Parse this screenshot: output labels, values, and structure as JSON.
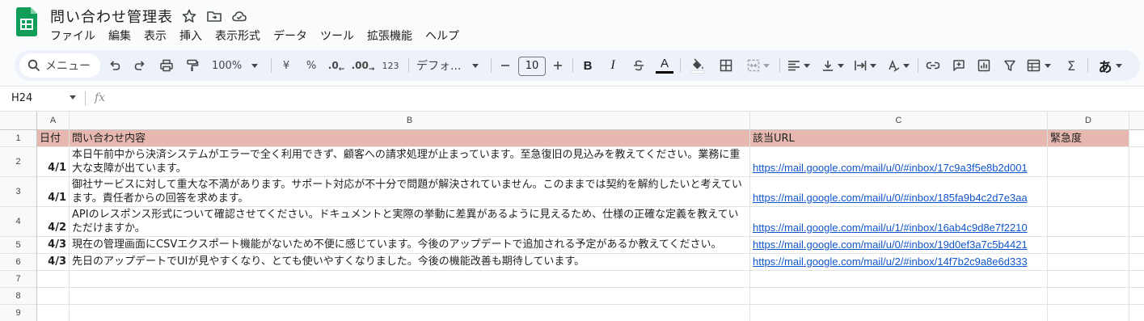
{
  "doc": {
    "title": "問い合わせ管理表"
  },
  "menu": [
    "ファイル",
    "編集",
    "表示",
    "挿入",
    "表示形式",
    "データ",
    "ツール",
    "拡張機能",
    "ヘルプ"
  ],
  "toolbar": {
    "search_label": "メニュー",
    "zoom": "100%",
    "currency": "¥",
    "percent": "%",
    "dec_decrease": ".0",
    "dec_increase": ".00",
    "number_format": "123",
    "font": "デフォ...",
    "font_size": "10",
    "bold": "B",
    "italic": "I",
    "text_color_letter": "A",
    "ime": "あ"
  },
  "formula_bar": {
    "name_box": "H24",
    "fx": "fx"
  },
  "columns": [
    "A",
    "B",
    "C",
    "D"
  ],
  "rows": [
    "1",
    "2",
    "3",
    "4",
    "5",
    "6",
    "7",
    "8",
    "9"
  ],
  "header_row": {
    "a": "日付",
    "b": "問い合わせ内容",
    "c": "該当URL",
    "d": "緊急度"
  },
  "data_rows": [
    {
      "date": "4/1",
      "content": "本日午前中から決済システムがエラーで全く利用できず、顧客への請求処理が止まっています。至急復旧の見込みを教えてください。業務に重大な支障が出ています。",
      "url": "https://mail.google.com/mail/u/0/#inbox/17c9a3f5e8b2d001"
    },
    {
      "date": "4/1",
      "content": "御社サービスに対して重大な不満があります。サポート対応が不十分で問題が解決されていません。このままでは契約を解約したいと考えています。責任者からの回答を求めます。",
      "url": "https://mail.google.com/mail/u/0/#inbox/185fa9b4c2d7e3aa"
    },
    {
      "date": "4/2",
      "content": "APIのレスポンス形式について確認させてください。ドキュメントと実際の挙動に差異があるように見えるため、仕様の正確な定義を教えていただけますか。",
      "url": "https://mail.google.com/mail/u/1/#inbox/16ab4c9d8e7f2210"
    },
    {
      "date": "4/3",
      "content": "現在の管理画面にCSVエクスポート機能がないため不便に感じています。今後のアップデートで追加される予定があるか教えてください。",
      "url": "https://mail.google.com/mail/u/0/#inbox/19d0ef3a7c5b4421"
    },
    {
      "date": "4/3",
      "content": "先日のアップデートでUIが見やすくなり、とても使いやすくなりました。今後の機能改善も期待しています。",
      "url": "https://mail.google.com/mail/u/2/#inbox/14f7b2c9a8e6d333"
    }
  ],
  "colors": {
    "header_fill": "#e6b8af",
    "link": "#1155cc",
    "toolbar_bg": "#edf2fa",
    "sheets_green": "#0f9d58"
  }
}
